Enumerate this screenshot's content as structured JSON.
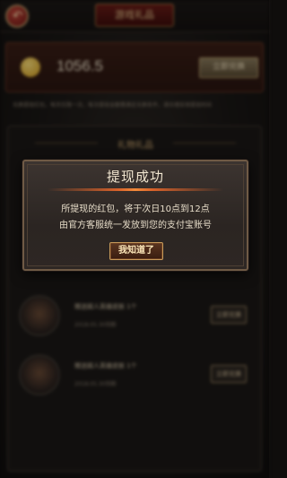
{
  "header": {
    "back_glyph": "↶",
    "title": "游戏礼品"
  },
  "balance": {
    "amount": "1056.5",
    "exchange_label": "立即兑换"
  },
  "notice": "兑换提现红包，每天仅限一次，每次提现金额需满足兑换条件，请合理安排提现时间",
  "gift_list": {
    "title": "礼物礼品",
    "items": [
      {
        "name": "赠送超人英雄皮肤 1个",
        "date": "2018.05.30到期",
        "action": "立即兑换"
      },
      {
        "name": "赠送超人英雄皮肤 1个",
        "date": "2018.05.30到期",
        "action": "立即兑换"
      }
    ]
  },
  "modal": {
    "title": "提现成功",
    "line1": "所提现的红包，将于次日10点到12点",
    "line2": "由官方客服统一发放到您的支付宝账号",
    "ok_label": "我知道了"
  },
  "colors": {
    "accent": "#d6612a",
    "gold": "#c79a5a",
    "background": "#1a1715"
  }
}
